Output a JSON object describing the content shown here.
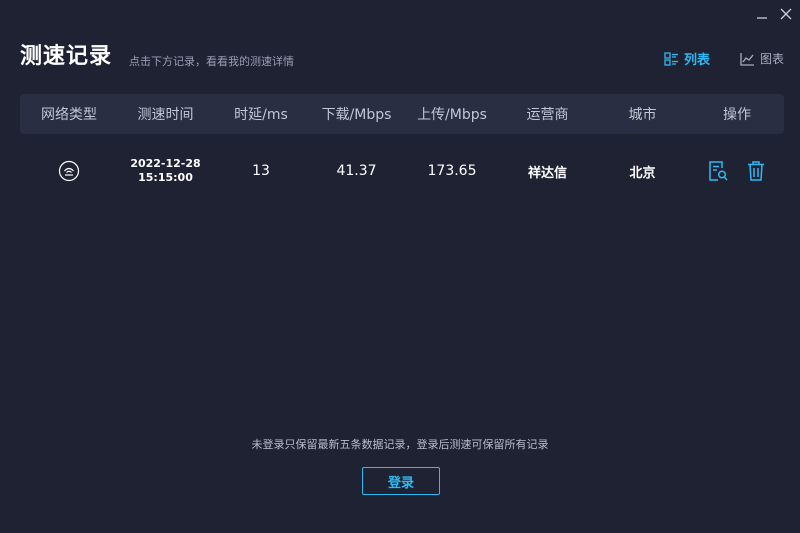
{
  "window": {
    "minimize_icon": "minimize-icon",
    "close_icon": "close-icon"
  },
  "header": {
    "title": "测速记录",
    "subtitle": "点击下方记录，看看我的测速详情"
  },
  "view_switch": {
    "list_label": "列表",
    "chart_label": "图表",
    "active": "list"
  },
  "table": {
    "columns": [
      "网络类型",
      "测速时间",
      "时延/ms",
      "下载/Mbps",
      "上传/Mbps",
      "运营商",
      "城市",
      "操作"
    ],
    "rows": [
      {
        "network_icon": "ethernet-icon",
        "date": "2022-12-28",
        "time": "15:15:00",
        "latency": "13",
        "download": "41.37",
        "upload": "173.65",
        "isp": "祥达信",
        "city": "北京",
        "actions": [
          "view-detail-icon",
          "delete-icon"
        ]
      }
    ]
  },
  "footer": {
    "notice": "未登录只保留最新五条数据记录，登录后测速可保留所有记录",
    "login_label": "登录"
  },
  "colors": {
    "background": "#1f2233",
    "header_row": "#2a2e42",
    "accent": "#2fb9f2"
  }
}
